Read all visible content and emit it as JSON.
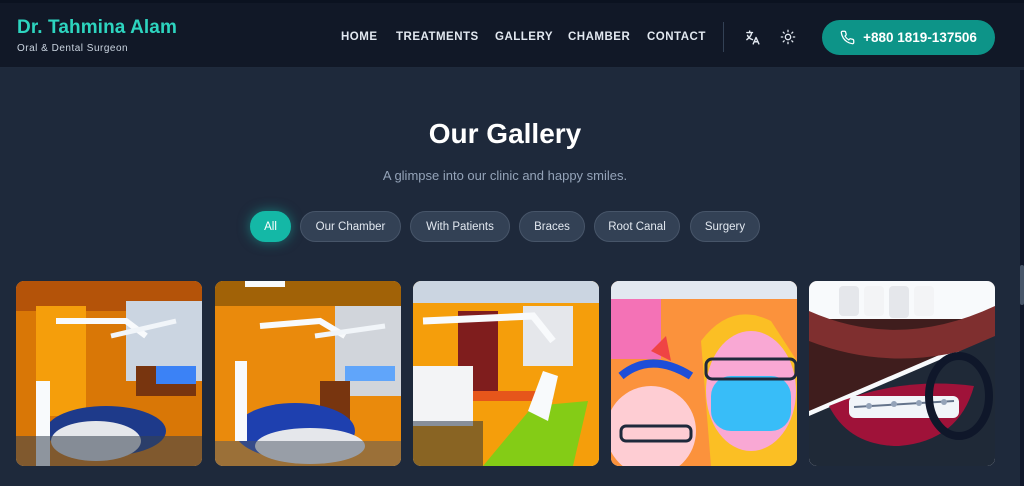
{
  "brand": {
    "name": "Dr. Tahmina Alam",
    "subtitle": "Oral & Dental Surgeon"
  },
  "nav": {
    "items": [
      {
        "label": "HOME"
      },
      {
        "label": "TREATMENTS"
      },
      {
        "label": "GALLERY"
      },
      {
        "label": "CHAMBER"
      },
      {
        "label": "CONTACT"
      }
    ],
    "language_icon": "translate-icon",
    "theme_icon": "sun-icon",
    "phone_icon": "phone-icon",
    "phone": "+880 1819-137506"
  },
  "gallery": {
    "title": "Our Gallery",
    "subtitle": "A glimpse into our clinic and happy smiles.",
    "filters": [
      {
        "label": "All",
        "active": true
      },
      {
        "label": "Our Chamber",
        "active": false
      },
      {
        "label": "With Patients",
        "active": false
      },
      {
        "label": "Braces",
        "active": false
      },
      {
        "label": "Root Canal",
        "active": false
      },
      {
        "label": "Surgery",
        "active": false
      }
    ],
    "images": [
      {
        "subject": "dental chair in clinic"
      },
      {
        "subject": "dental chair in clinic"
      },
      {
        "subject": "dental unit with green cover"
      },
      {
        "subject": "selfie with patient"
      },
      {
        "subject": "braces close-up"
      }
    ]
  },
  "colors": {
    "accent": "#14b8a6",
    "brand_text": "#2dd4bf",
    "navbar_bg": "#111827",
    "page_bg": "#1e293b"
  }
}
